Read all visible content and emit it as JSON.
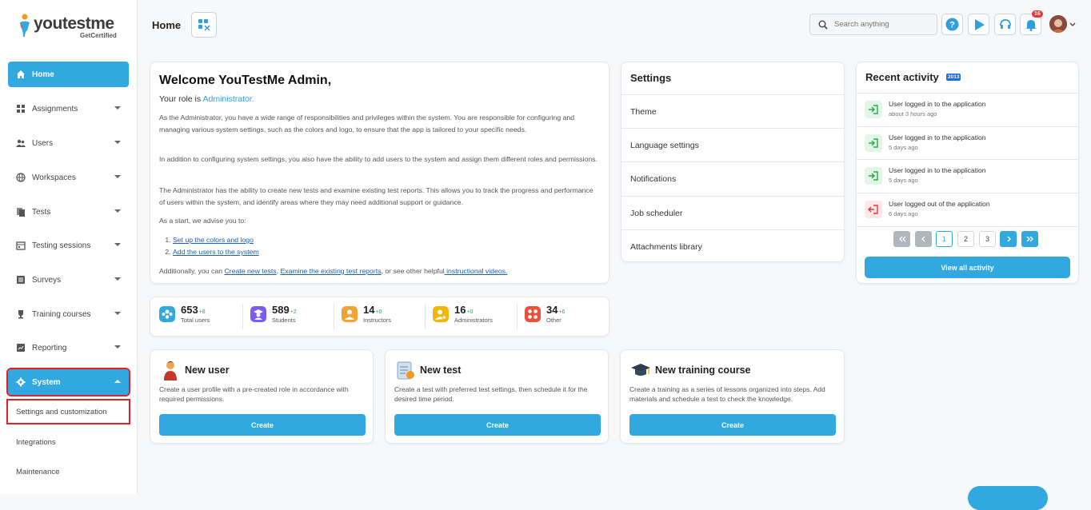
{
  "brand": {
    "name_a": "you",
    "name_b": "testme",
    "sub": "GetCertified"
  },
  "sidebar": {
    "items": [
      {
        "label": "Home",
        "icon": "home-icon"
      },
      {
        "label": "Assignments",
        "icon": "assignments-icon"
      },
      {
        "label": "Users",
        "icon": "users-icon"
      },
      {
        "label": "Workspaces",
        "icon": "globe-icon"
      },
      {
        "label": "Tests",
        "icon": "tests-icon"
      },
      {
        "label": "Testing sessions",
        "icon": "calendar-icon"
      },
      {
        "label": "Surveys",
        "icon": "survey-icon"
      },
      {
        "label": "Training courses",
        "icon": "trophy-icon"
      },
      {
        "label": "Reporting",
        "icon": "chart-icon"
      },
      {
        "label": "System",
        "icon": "gear-icon"
      }
    ],
    "subitems": [
      "Settings and customization",
      "Integrations",
      "Maintenance"
    ]
  },
  "header": {
    "title": "Home",
    "search_placeholder": "Search anything",
    "notifications": "16"
  },
  "welcome": {
    "title": "Welcome YouTestMe Admin,",
    "role_prefix": "Your role is ",
    "role": "Administrator.",
    "p1": "As the Administrator, you have a wide range of responsibilities and privileges within the system. You are responsible for configuring and managing various system settings, such as the colors and logo, to ensure that the app is tailored to your specific needs.",
    "p2": "In addition to configuring system settings, you also have the ability to add users to the system and assign them different roles and permissions.",
    "p3": "The Administrator has the ability to create new tests and examine existing test reports. This allows you to track the progress and performance of users within the system, and identify areas where they may need additional support or guidance.",
    "p4": "As a start, we advise you to:",
    "steps": [
      "Set up the colors and logo",
      "Add the users to the system"
    ],
    "add_prefix": "Additionally, you can ",
    "link_create": "Create new tests",
    "sep": ", ",
    "link_examine": "Examine the existing test reports",
    "mid": ", or see other helpful",
    "link_videos": " instructional videos."
  },
  "stats": [
    {
      "num": "653",
      "delta": "+8",
      "label": "Total users",
      "color": "#31a8df"
    },
    {
      "num": "589",
      "delta": "+2",
      "label": "Students",
      "color": "#7b5cf0"
    },
    {
      "num": "14",
      "delta": "+0",
      "label": "Instructors",
      "color": "#f2a233"
    },
    {
      "num": "16",
      "delta": "+0",
      "label": "Administrators",
      "color": "#f2b705"
    },
    {
      "num": "34",
      "delta": "+6",
      "label": "Other",
      "color": "#e8523a"
    }
  ],
  "actions": [
    {
      "title": "New user",
      "desc": "Create a user profile with a pre-created role in accordance with required permissions.",
      "button": "Create"
    },
    {
      "title": "New test",
      "desc": "Create a test with preferred test settings, then schedule it for the desired time period.",
      "button": "Create"
    },
    {
      "title": "New training course",
      "desc": "Create a training as a series of lessons organized into steps. Add materials and schedule a test to check the knowledge.",
      "button": "Create"
    }
  ],
  "settings": {
    "title": "Settings",
    "items": [
      "Theme",
      "Language settings",
      "Notifications",
      "Job scheduler",
      "Attachments library"
    ]
  },
  "recent": {
    "title": "Recent activity",
    "count": "2013",
    "items": [
      {
        "text": "User logged in to the application",
        "time": "about 3 hours ago",
        "type": "login"
      },
      {
        "text": "User logged in to the application",
        "time": "5 days ago",
        "type": "login"
      },
      {
        "text": "User logged in to the application",
        "time": "5 days ago",
        "type": "login"
      },
      {
        "text": "User logged out of the application",
        "time": "6 days ago",
        "type": "logout"
      }
    ],
    "pages": [
      "1",
      "2",
      "3"
    ],
    "view_all": "View all activity"
  }
}
